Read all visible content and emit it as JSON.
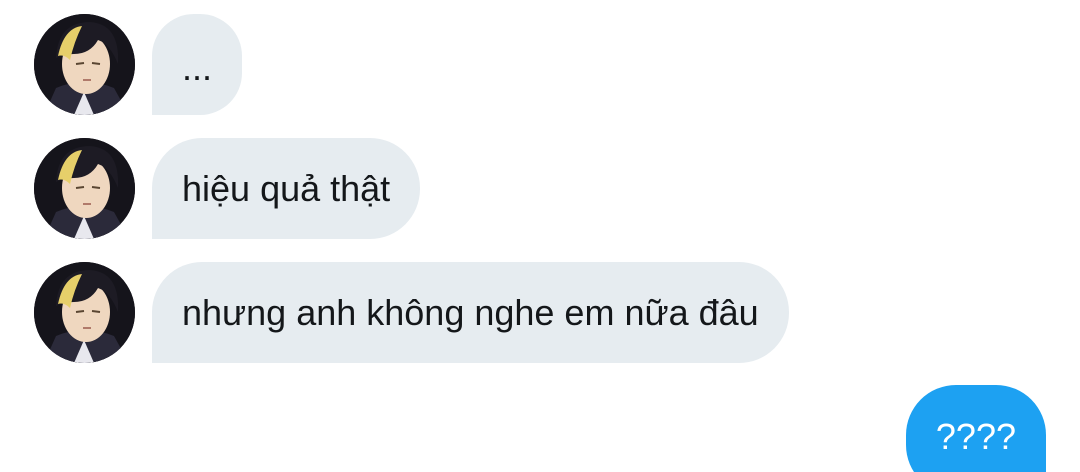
{
  "conversation": {
    "messages": [
      {
        "direction": "received",
        "text": "..."
      },
      {
        "direction": "received",
        "text": "hiệu quả thật"
      },
      {
        "direction": "received",
        "text": "nhưng anh không nghe em nữa đâu"
      },
      {
        "direction": "sent",
        "text": "????"
      }
    ]
  },
  "colors": {
    "received_bubble": "#e6ecf0",
    "received_text": "#14171a",
    "sent_bubble": "#1da1f2",
    "sent_text": "#ffffff"
  },
  "icons": {
    "avatar": "user-avatar-image"
  }
}
